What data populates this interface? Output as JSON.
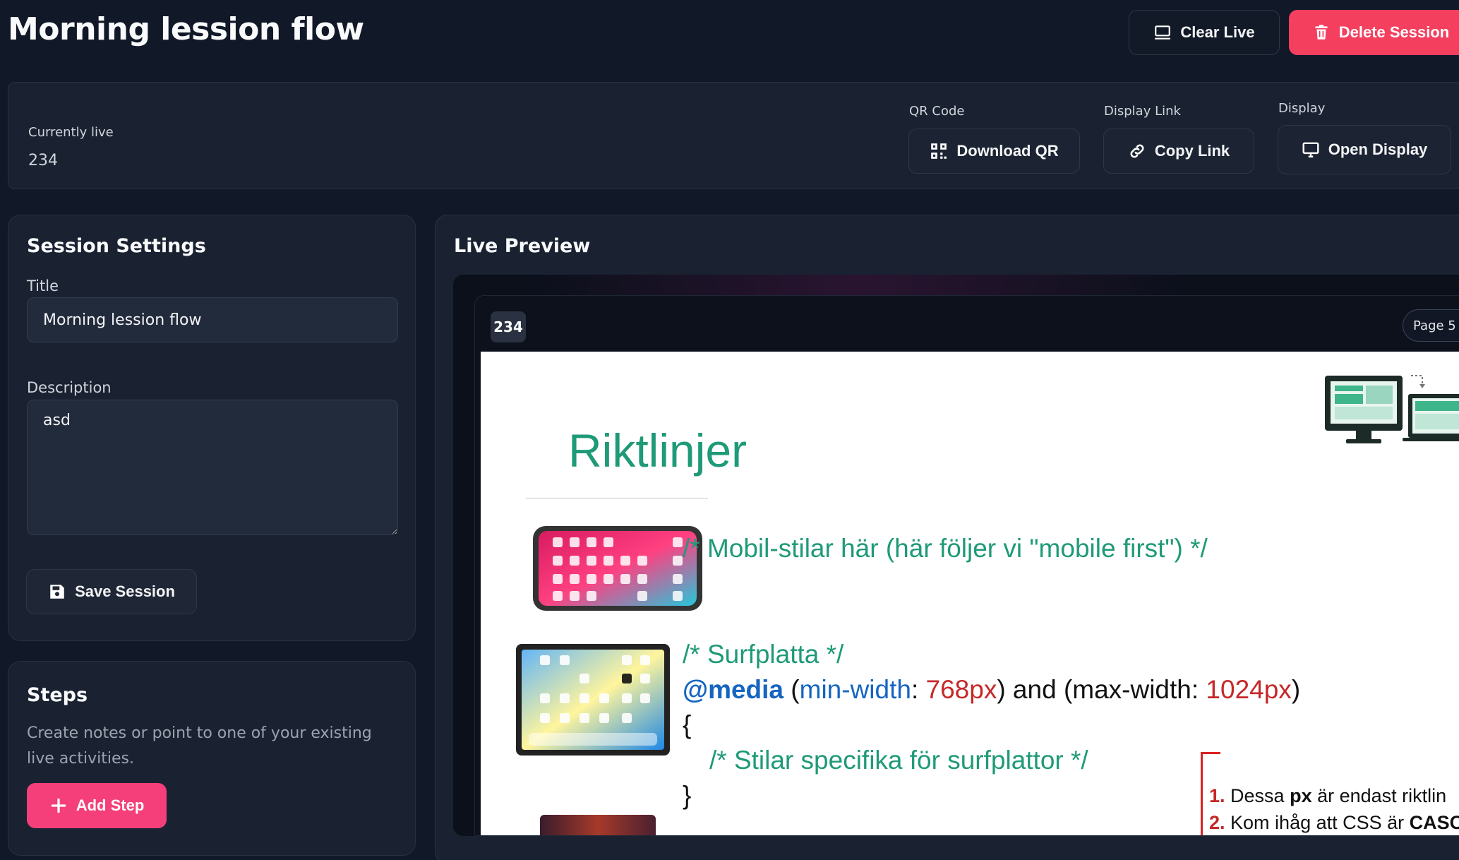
{
  "header": {
    "title": "Morning lession flow",
    "clear_live_label": "Clear Live",
    "delete_session_label": "Delete Session"
  },
  "live_panel": {
    "currently_live_label": "Currently live",
    "currently_live_value": "234",
    "qr_label": "QR Code",
    "qr_button": "Download QR",
    "link_label": "Display Link",
    "link_button": "Copy Link",
    "display_label": "Display",
    "display_button": "Open Display"
  },
  "settings": {
    "heading": "Session Settings",
    "title_label": "Title",
    "title_value": "Morning lession flow",
    "description_label": "Description",
    "description_value": "asd",
    "save_button": "Save Session"
  },
  "steps": {
    "heading": "Steps",
    "help": "Create notes or point to one of your existing live activities.",
    "add_button": "Add Step"
  },
  "preview": {
    "heading": "Live Preview",
    "badge": "234",
    "page_pill": "Page 5",
    "slide": {
      "title": "Riktlinjer",
      "mobile_comment": "/* Mobil-stilar här (här följer vi \"mobile first\") */",
      "tablet_comment": "/* Surfplatta */",
      "media_kw": "@media",
      "paren_open": " (",
      "min_prop": "min-width",
      "colon1": ": ",
      "min_val": "768px",
      "and_text": ") and (max-width: ",
      "max_val": "1024px",
      "paren_close": ")",
      "brace_open": "{",
      "inner_comment": "/* Stilar specifika för surfplattor */",
      "brace_close": "}",
      "note1_num": "1.",
      "note1_a": " Dessa ",
      "note1_b": "px",
      "note1_c": " är endast riktlin",
      "note2_num": "2.",
      "note2_a": " Kom ihåg att CSS är ",
      "note2_b": "CASC"
    }
  },
  "colors": {
    "background": "#111828",
    "card": "#1a2232",
    "accent_pink": "#f43f5e",
    "add_pink": "#f43f7a",
    "slide_green": "#1f9a78"
  }
}
